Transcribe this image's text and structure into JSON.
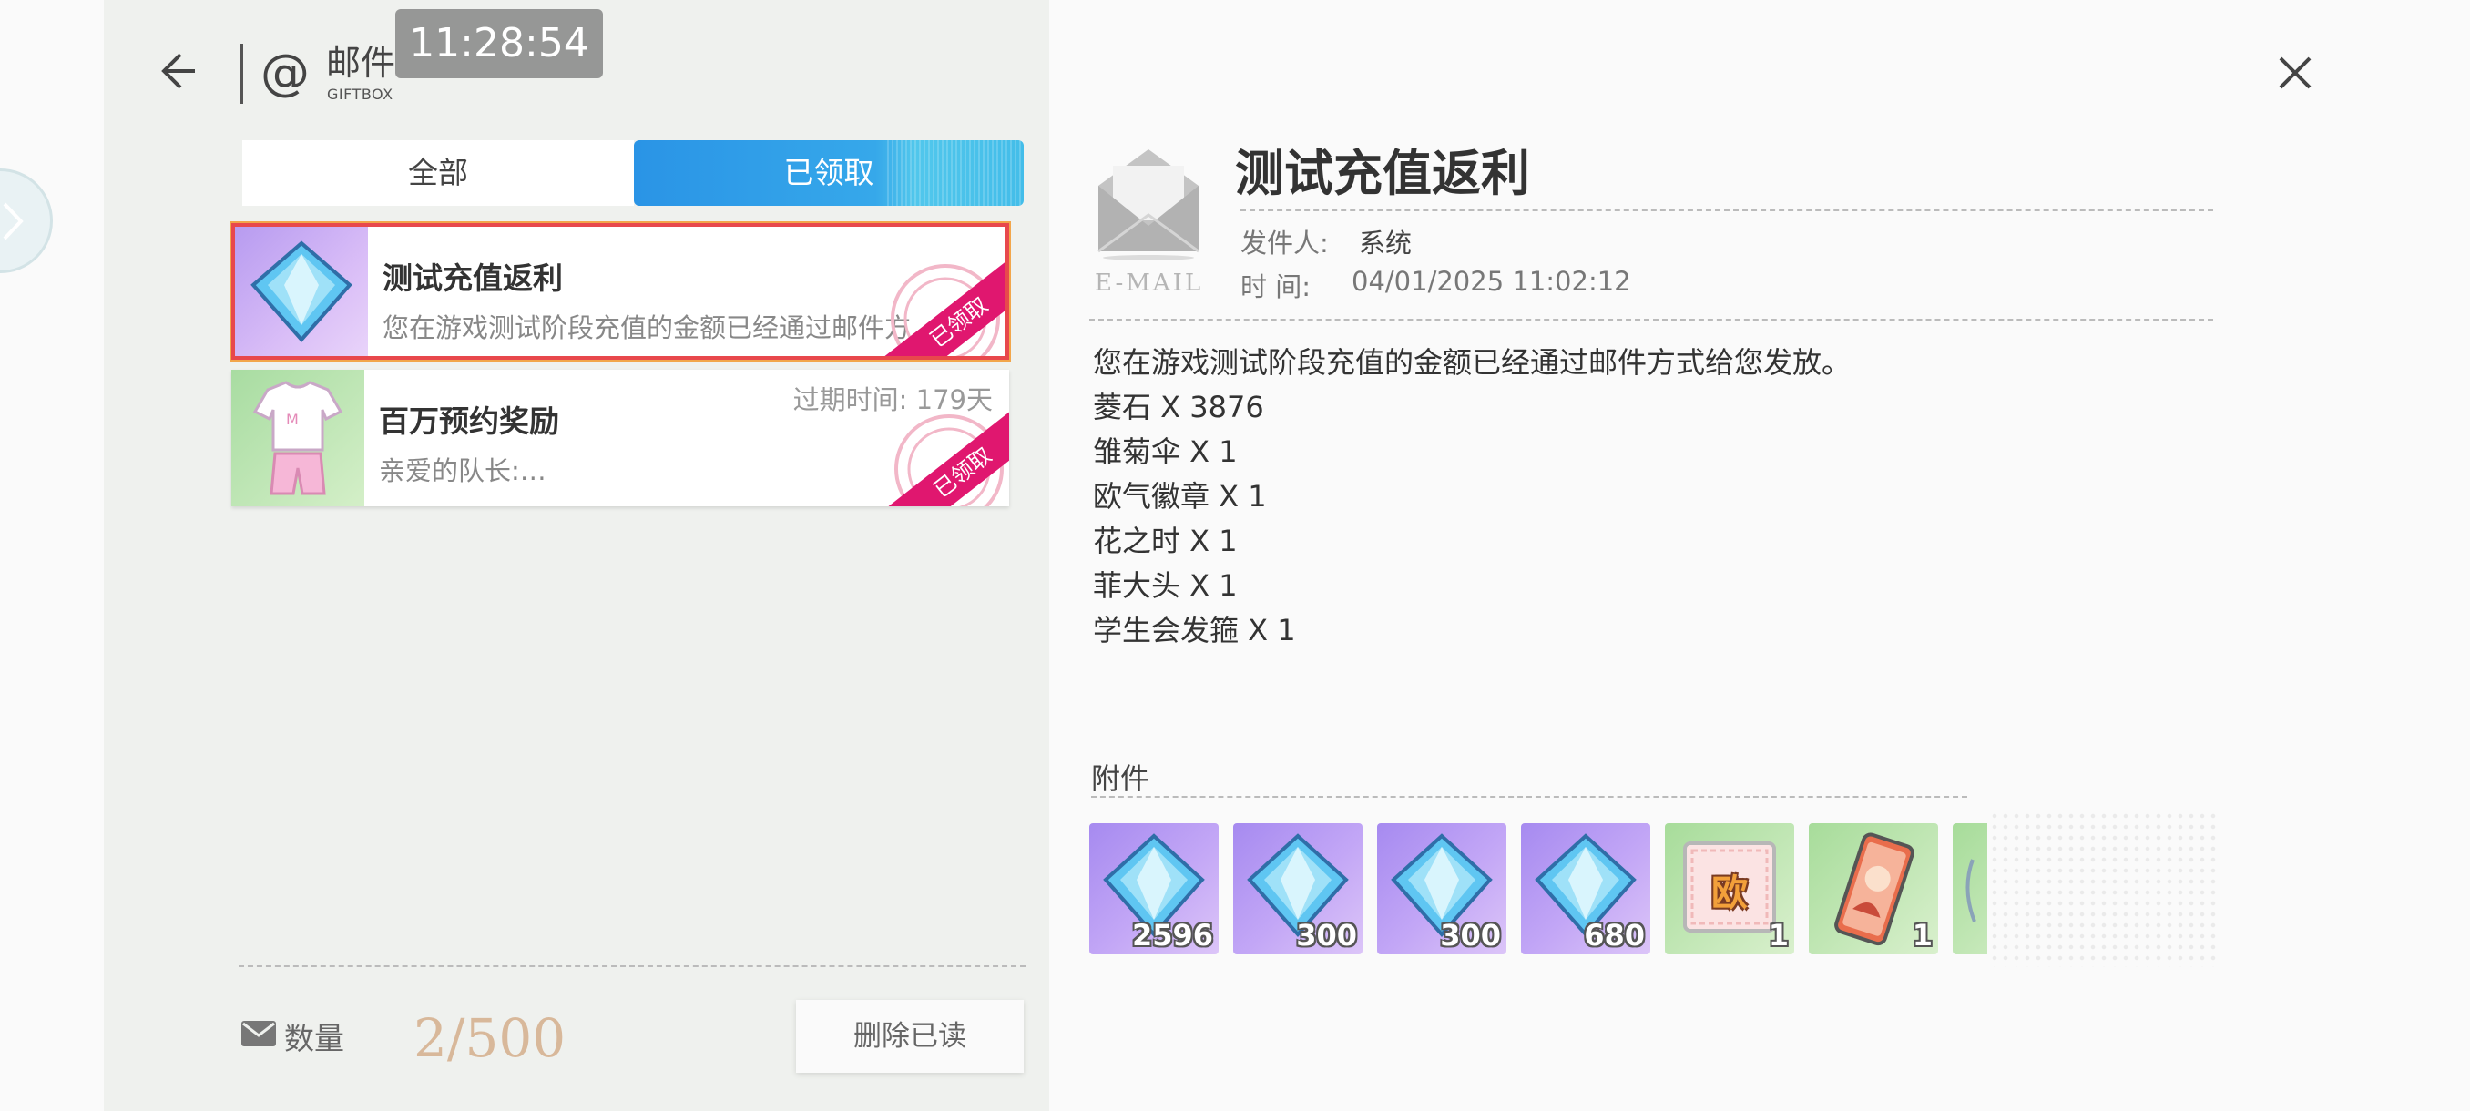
{
  "header": {
    "title": "邮件",
    "subtitle": "GIFTBOX",
    "clock": "11:28:54"
  },
  "tabs": [
    {
      "label": "全部",
      "active": false
    },
    {
      "label": "已领取",
      "active": true
    }
  ],
  "mail_list": [
    {
      "title": "测试充值返利",
      "preview": "您在游戏测试阶段充值的金额已经通过邮件方…",
      "stamp": "已领取",
      "selected": true,
      "icon": "gem-icon"
    },
    {
      "title": "百万预约奖励",
      "preview": "亲爱的队长:…",
      "expiry": "过期时间: 179天",
      "stamp": "已领取",
      "selected": false,
      "icon": "outfit-icon"
    }
  ],
  "footer": {
    "count_label": "数量",
    "count_value": "2/500",
    "delete_button": "删除已读"
  },
  "detail": {
    "title": "测试充值返利",
    "email_icon_label": "E-MAIL",
    "sender_label": "发件人:",
    "sender_value": "系统",
    "time_label": "时 间:",
    "time_value": "04/01/2025 11:02:12",
    "body": [
      "您在游戏测试阶段充值的金额已经通过邮件方式给您发放。",
      "菱石 X 3876",
      "雏菊伞 X 1",
      "欧气徽章 X 1",
      "花之时 X 1",
      "菲大头 X 1",
      "学生会发箍 X 1"
    ],
    "attachments_label": "附件",
    "attachments": [
      {
        "icon": "gem-icon",
        "qty": "2596",
        "bg": "purple"
      },
      {
        "icon": "gem-icon",
        "qty": "300",
        "bg": "purple"
      },
      {
        "icon": "gem-icon",
        "qty": "300",
        "bg": "purple"
      },
      {
        "icon": "gem-icon",
        "qty": "680",
        "bg": "purple"
      },
      {
        "icon": "lucky-badge-icon",
        "qty": "1",
        "bg": "green",
        "badge_text": "欧"
      },
      {
        "icon": "photo-card-icon",
        "qty": "1",
        "bg": "green"
      },
      {
        "icon": "item-icon",
        "qty": "",
        "bg": "green"
      }
    ]
  },
  "colors": {
    "tab_active": "#2a94e6",
    "selected_border": "#e8484c",
    "stamp": "#e0176f",
    "count_value": "#d8b89a"
  }
}
